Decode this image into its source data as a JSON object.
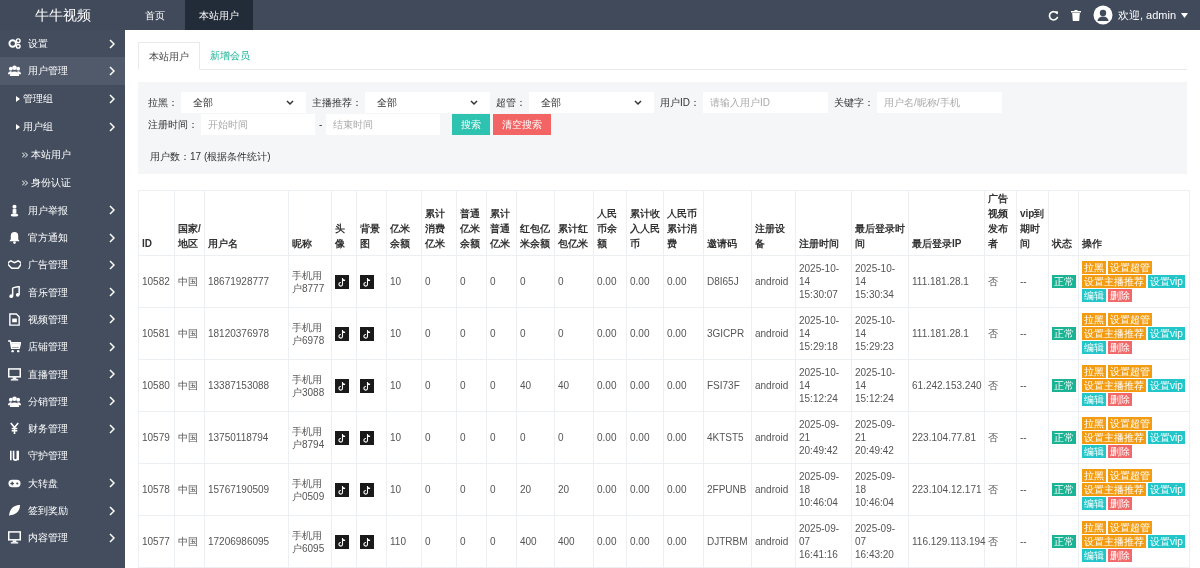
{
  "brand": "牛牛视频",
  "top_tabs": [
    {
      "label": "首页",
      "selected": false
    },
    {
      "label": "本站用户",
      "selected": true
    }
  ],
  "user_menu": {
    "greeting": "欢迎, admin"
  },
  "sidebar": {
    "items": [
      {
        "label": "设置",
        "kind": "menu",
        "expanded": false
      },
      {
        "label": "用户管理",
        "kind": "menu",
        "expanded": true,
        "children": [
          {
            "label": "管理组",
            "kind": "menu"
          },
          {
            "label": "用户组",
            "kind": "menu"
          },
          {
            "label": "本站用户",
            "kind": "link"
          },
          {
            "label": "身份认证",
            "kind": "link"
          }
        ]
      },
      {
        "label": "用户举报",
        "kind": "menu",
        "expanded": false
      },
      {
        "label": "官方通知",
        "kind": "menu",
        "expanded": false
      },
      {
        "label": "广告管理",
        "kind": "menu",
        "expanded": false
      },
      {
        "label": "音乐管理",
        "kind": "menu",
        "expanded": false
      },
      {
        "label": "视频管理",
        "kind": "menu",
        "expanded": false
      },
      {
        "label": "店铺管理",
        "kind": "menu",
        "expanded": false
      },
      {
        "label": "直播管理",
        "kind": "menu",
        "expanded": false
      },
      {
        "label": "分销管理",
        "kind": "menu",
        "expanded": false
      },
      {
        "label": "财务管理",
        "kind": "menu",
        "expanded": false
      },
      {
        "label": "守护管理",
        "kind": "link",
        "expanded": false
      },
      {
        "label": "大转盘",
        "kind": "menu",
        "expanded": false
      },
      {
        "label": "签到奖励",
        "kind": "menu",
        "expanded": false
      },
      {
        "label": "内容管理",
        "kind": "menu",
        "expanded": false
      }
    ]
  },
  "tabs": [
    {
      "label": "本站用户",
      "selected": true
    },
    {
      "label": "新增会员",
      "selected": false
    }
  ],
  "filters": [
    {
      "label": "拉黑：",
      "kind": "select",
      "value": "全部"
    },
    {
      "label": "主播推荐：",
      "kind": "select",
      "value": "全部"
    },
    {
      "label": "超管：",
      "kind": "select",
      "value": "全部"
    },
    {
      "label": "用户ID：",
      "kind": "input",
      "placeholder": "请输入用户ID"
    },
    {
      "label": "关键字：",
      "kind": "input",
      "placeholder": "用户名/昵称/手机"
    }
  ],
  "date_filter": {
    "label": "注册时间：",
    "start_placeholder": "开始时间",
    "separator": "-",
    "end_placeholder": "结束时间"
  },
  "buttons": [
    {
      "label": "搜索",
      "kind": "primary"
    },
    {
      "label": "清空搜索",
      "kind": "danger"
    }
  ],
  "summary": "用户数：17 (根据条件统计)",
  "table": {
    "columns": [
      {
        "label": "ID",
        "kind": "text"
      },
      {
        "label": "国家/地区",
        "kind": "text"
      },
      {
        "label": "用户名",
        "kind": "text"
      },
      {
        "label": "昵称",
        "kind": "text"
      },
      {
        "label": "头像",
        "kind": "image"
      },
      {
        "label": "背景图",
        "kind": "image"
      },
      {
        "label": "亿米余额",
        "kind": "text"
      },
      {
        "label": "累计消费亿米",
        "kind": "text"
      },
      {
        "label": "普通亿米余额",
        "kind": "text"
      },
      {
        "label": "累计普通亿米",
        "kind": "text"
      },
      {
        "label": "红包亿米余额",
        "kind": "text"
      },
      {
        "label": "累计红包亿米",
        "kind": "text"
      },
      {
        "label": "人民币余额",
        "kind": "text"
      },
      {
        "label": "累计收入人民币",
        "kind": "text"
      },
      {
        "label": "人民币累计消费",
        "kind": "text"
      },
      {
        "label": "邀请码",
        "kind": "text"
      },
      {
        "label": "注册设备",
        "kind": "text"
      },
      {
        "label": "注册时间",
        "kind": "text"
      },
      {
        "label": "最后登录时间",
        "kind": "text"
      },
      {
        "label": "最后登录IP",
        "kind": "text"
      },
      {
        "label": "广告视频发布者",
        "kind": "text"
      },
      {
        "label": "vip到期时间",
        "kind": "text"
      },
      {
        "label": "状态",
        "kind": "status"
      },
      {
        "label": "操作",
        "kind": "actions"
      }
    ],
    "rows": [
      {
        "cells": [
          "10582",
          "中国",
          "18671928777",
          "手机用户8777",
          "",
          "",
          "10",
          "0",
          "0",
          "0",
          "0",
          "0",
          "0.00",
          "0.00",
          "0.00",
          "D8I65J",
          "android",
          "2025-10-14 15:30:07",
          "2025-10-14 15:30:34",
          "111.181.28.1",
          "否",
          "--"
        ],
        "status": {
          "label": "正常",
          "kind": "normal"
        },
        "actions": [
          {
            "label": "拉黑",
            "kind": "warning"
          },
          {
            "label": "设置超管",
            "kind": "warning"
          },
          {
            "label": "设置主播推荐",
            "kind": "warning"
          },
          {
            "label": "设置vip",
            "kind": "info"
          },
          {
            "label": "编辑",
            "kind": "info"
          },
          {
            "label": "删除",
            "kind": "danger"
          }
        ]
      },
      {
        "cells": [
          "10581",
          "中国",
          "18120376978",
          "手机用户6978",
          "",
          "",
          "10",
          "0",
          "0",
          "0",
          "0",
          "0",
          "0.00",
          "0.00",
          "0.00",
          "3GICPR",
          "android",
          "2025-10-14 15:29:18",
          "2025-10-14 15:29:23",
          "111.181.28.1",
          "否",
          "--"
        ],
        "status": {
          "label": "正常",
          "kind": "normal"
        },
        "actions": [
          {
            "label": "拉黑",
            "kind": "warning"
          },
          {
            "label": "设置超管",
            "kind": "warning"
          },
          {
            "label": "设置主播推荐",
            "kind": "warning"
          },
          {
            "label": "设置vip",
            "kind": "info"
          },
          {
            "label": "编辑",
            "kind": "info"
          },
          {
            "label": "删除",
            "kind": "danger"
          }
        ]
      },
      {
        "cells": [
          "10580",
          "中国",
          "13387153088",
          "手机用户3088",
          "",
          "",
          "10",
          "0",
          "0",
          "0",
          "40",
          "40",
          "0.00",
          "0.00",
          "0.00",
          "FSI73F",
          "android",
          "2025-10-14 15:12:24",
          "2025-10-14 15:12:24",
          "61.242.153.240",
          "否",
          "--"
        ],
        "status": {
          "label": "正常",
          "kind": "normal"
        },
        "actions": [
          {
            "label": "拉黑",
            "kind": "warning"
          },
          {
            "label": "设置超管",
            "kind": "warning"
          },
          {
            "label": "设置主播推荐",
            "kind": "warning"
          },
          {
            "label": "设置vip",
            "kind": "info"
          },
          {
            "label": "编辑",
            "kind": "info"
          },
          {
            "label": "删除",
            "kind": "danger"
          }
        ]
      },
      {
        "cells": [
          "10579",
          "中国",
          "13750118794",
          "手机用户8794",
          "",
          "",
          "10",
          "0",
          "0",
          "0",
          "0",
          "0",
          "0.00",
          "0.00",
          "0.00",
          "4KTST5",
          "android",
          "2025-09-21 20:49:42",
          "2025-09-21 20:49:42",
          "223.104.77.81",
          "否",
          "--"
        ],
        "status": {
          "label": "正常",
          "kind": "normal"
        },
        "actions": [
          {
            "label": "拉黑",
            "kind": "warning"
          },
          {
            "label": "设置超管",
            "kind": "warning"
          },
          {
            "label": "设置主播推荐",
            "kind": "warning"
          },
          {
            "label": "设置vip",
            "kind": "info"
          },
          {
            "label": "编辑",
            "kind": "info"
          },
          {
            "label": "删除",
            "kind": "danger"
          }
        ]
      },
      {
        "cells": [
          "10578",
          "中国",
          "15767190509",
          "手机用户0509",
          "",
          "",
          "10",
          "0",
          "0",
          "0",
          "20",
          "20",
          "0.00",
          "0.00",
          "0.00",
          "2FPUNB",
          "android",
          "2025-09-18 10:46:04",
          "2025-09-18 10:46:04",
          "223.104.12.171",
          "否",
          "--"
        ],
        "status": {
          "label": "正常",
          "kind": "normal"
        },
        "actions": [
          {
            "label": "拉黑",
            "kind": "warning"
          },
          {
            "label": "设置超管",
            "kind": "warning"
          },
          {
            "label": "设置主播推荐",
            "kind": "warning"
          },
          {
            "label": "设置vip",
            "kind": "info"
          },
          {
            "label": "编辑",
            "kind": "info"
          },
          {
            "label": "删除",
            "kind": "danger"
          }
        ]
      },
      {
        "cells": [
          "10577",
          "中国",
          "17206986095",
          "手机用户6095",
          "",
          "",
          "110",
          "0",
          "0",
          "0",
          "400",
          "400",
          "0.00",
          "0.00",
          "0.00",
          "DJTRBM",
          "android",
          "2025-09-07 16:41:16",
          "2025-09-07 16:43:20",
          "116.129.113.194",
          "否",
          "--"
        ],
        "status": {
          "label": "正常",
          "kind": "normal"
        },
        "actions": [
          {
            "label": "拉黑",
            "kind": "warning"
          },
          {
            "label": "设置超管",
            "kind": "warning"
          },
          {
            "label": "设置主播推荐",
            "kind": "warning"
          },
          {
            "label": "设置vip",
            "kind": "info"
          },
          {
            "label": "编辑",
            "kind": "info"
          },
          {
            "label": "删除",
            "kind": "danger"
          }
        ]
      }
    ]
  }
}
